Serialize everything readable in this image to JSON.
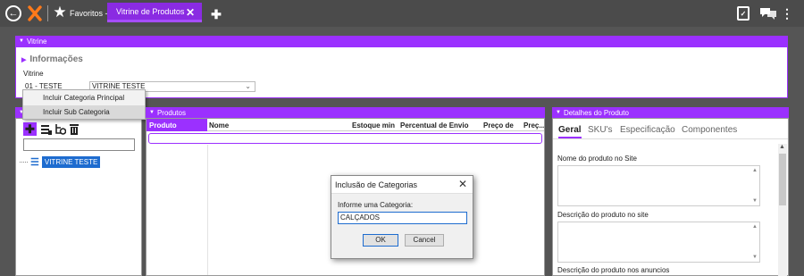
{
  "topbar": {
    "favorites_label": "Favoritos -",
    "active_tab_label": "Vitrine de Produtos",
    "close_glyph": "✕",
    "add_tab_glyph": "✚"
  },
  "vitrine_panel": {
    "title": "Vitrine",
    "section_title": "Informações",
    "field_label": "Vitrine",
    "code_value": "01 - TESTE",
    "name_value": "VITRINE TESTE"
  },
  "context_menu": {
    "items": [
      "Incluir Categoria Principal",
      "Incluir Sub Categoria"
    ]
  },
  "tree": {
    "root_label": "VITRINE TESTE"
  },
  "produtos_panel": {
    "title": "Produtos",
    "columns": [
      "Produto",
      "Nome",
      "Estoque min",
      "Percentual de Envio",
      "Preço de",
      "Preç..."
    ]
  },
  "detalhes_panel": {
    "title": "Detalhes do Produto",
    "tabs": [
      "Geral",
      "SKU's",
      "Especificação",
      "Componentes"
    ],
    "fields": [
      "Nome do produto no Site",
      "Descrição do produto no site",
      "Descrição do produto nos anuncios"
    ]
  },
  "dialog": {
    "title": "Inclusão de Categorias",
    "label": "Informe uma Categoria:",
    "input_value": "CALÇADOS",
    "ok_label": "OK",
    "cancel_label": "Cancel"
  },
  "colors": {
    "accent": "#9b30ff",
    "topbar": "#4b4b4b",
    "selection": "#1e6ccf"
  }
}
